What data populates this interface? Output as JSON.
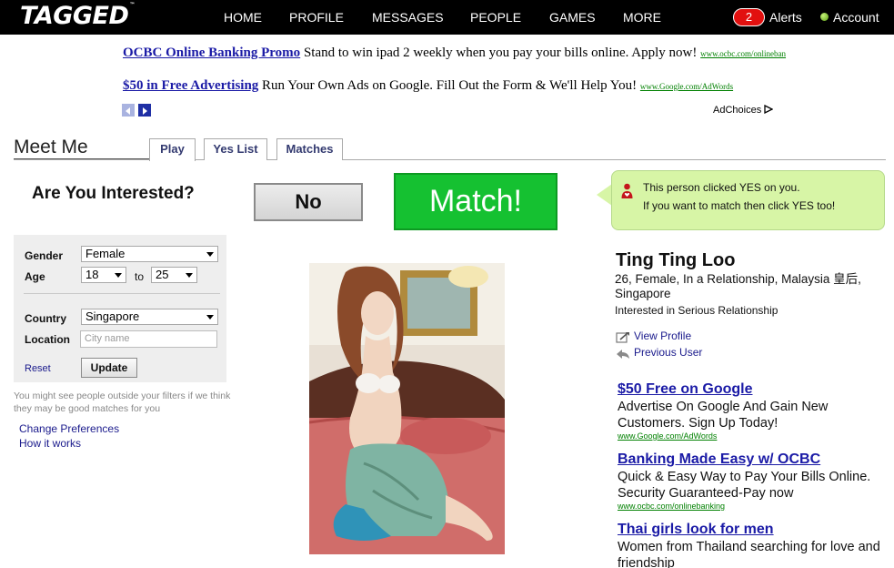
{
  "colors": {
    "nav_bg": "#000000",
    "alert_badge": "#e2100f",
    "match_green": "#15c131",
    "notice_bg": "#d7f5a6",
    "link_blue": "#1a1aa6",
    "ad_url_green": "#008000"
  },
  "header": {
    "logo": "TAGGED",
    "logo_tm": "™",
    "nav": [
      {
        "label": "HOME"
      },
      {
        "label": "PROFILE"
      },
      {
        "label": "MESSAGES"
      },
      {
        "label": "PEOPLE"
      },
      {
        "label": "GAMES"
      },
      {
        "label": "MORE"
      }
    ],
    "alerts_count": "2",
    "alerts_label": "Alerts",
    "account_label": "Account"
  },
  "top_ads": [
    {
      "title": "OCBC Online Banking Promo",
      "text": " Stand to win ipad 2 weekly when you pay your bills online. Apply now! ",
      "url": "www.ocbc.com/onlineban"
    },
    {
      "title": "$50 in Free Advertising",
      "text": " Run Your Own Ads on Google. Fill Out the Form & We'll Help You! ",
      "url": "www.Google.com/AdWords"
    }
  ],
  "adchoices_label": "AdChoices",
  "meet_me": {
    "title": "Meet Me",
    "tabs": [
      {
        "label": "Play"
      },
      {
        "label": "Yes List"
      },
      {
        "label": "Matches"
      }
    ],
    "question": "Are You Interested?",
    "no_label": "No",
    "match_label": "Match!",
    "notice_line1": "This person clicked YES on you.",
    "notice_line2": "If you want to match then click YES too!"
  },
  "filters": {
    "gender_label": "Gender",
    "gender_value": "Female",
    "age_label": "Age",
    "age_min": "18",
    "age_to": "to",
    "age_max": "25",
    "country_label": "Country",
    "country_value": "Singapore",
    "location_label": "Location",
    "location_placeholder": "City name",
    "reset_label": "Reset",
    "update_label": "Update",
    "note": "You might see people outside your filters if we think they may be good matches for you",
    "change_prefs": "Change Preferences",
    "how_it_works": "How it works"
  },
  "profile": {
    "name": "Ting Ting Loo",
    "details": "26, Female, In a Relationship, Malaysia 皇后, Singapore",
    "interest": "Interested in Serious Relationship",
    "view_profile": "View Profile",
    "previous_user": "Previous User"
  },
  "side_ads": [
    {
      "title": "$50 Free on Google",
      "body": "Advertise On Google And Gain New Customers. Sign Up Today!",
      "url": "www.Google.com/AdWords"
    },
    {
      "title": "Banking Made Easy w/ OCBC",
      "body": "Quick & Easy Way to Pay Your Bills Online. Security Guaranteed-Pay now",
      "url": "www.ocbc.com/onlinebanking"
    },
    {
      "title": "Thai girls look for men",
      "body": "Women from Thailand searching for love and friendship",
      "url": ""
    }
  ]
}
